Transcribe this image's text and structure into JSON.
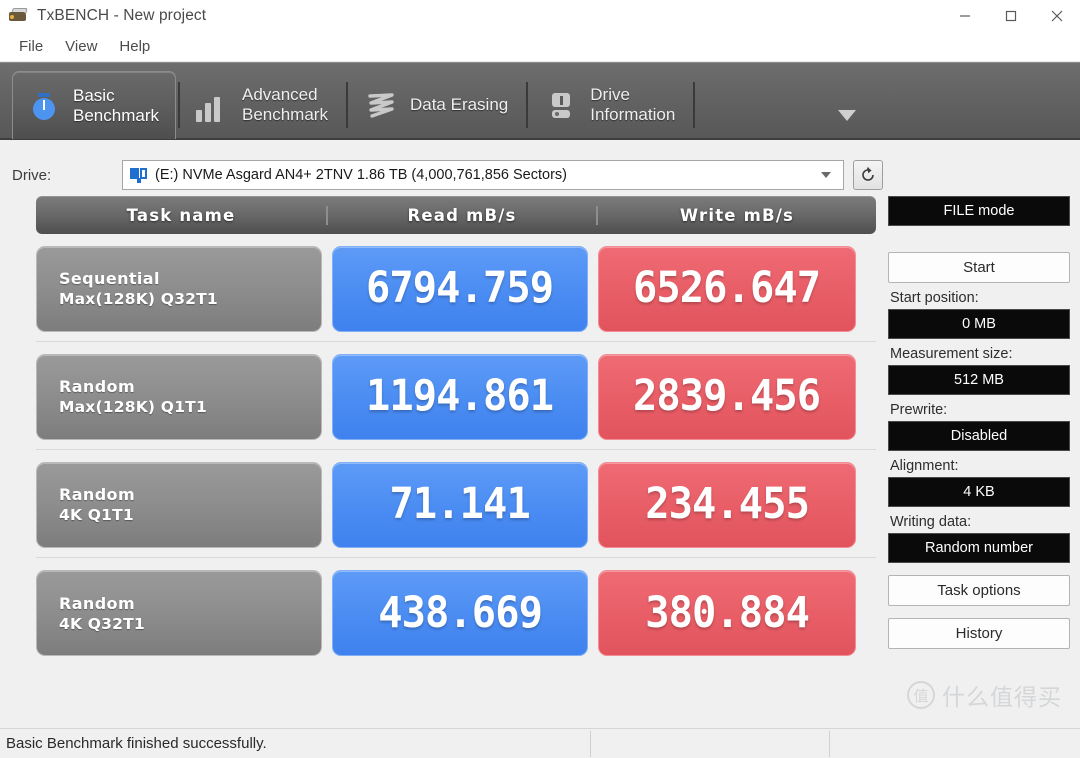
{
  "window": {
    "title": "TxBENCH - New project",
    "app_icon": "hdd-icon",
    "controls": [
      {
        "name": "minimize-button",
        "glyph": "minimize-icon"
      },
      {
        "name": "maximize-button",
        "glyph": "maximize-icon"
      },
      {
        "name": "close-button",
        "glyph": "close-icon"
      }
    ]
  },
  "menubar": {
    "items": [
      {
        "label": "File"
      },
      {
        "label": "View"
      },
      {
        "label": "Help"
      }
    ]
  },
  "tabs": {
    "overflow_icon": "chevron-down-icon",
    "items": [
      {
        "label": "Basic\nBenchmark",
        "icon": "stopwatch-icon",
        "active": true
      },
      {
        "label": "Advanced\nBenchmark",
        "icon": "bar-chart-icon",
        "active": false
      },
      {
        "label": "Data Erasing",
        "icon": "eraser-icon",
        "active": false
      },
      {
        "label": "Drive\nInformation",
        "icon": "drive-info-icon",
        "active": false
      }
    ]
  },
  "drive": {
    "label": "Drive:",
    "icon": "hdd-icon",
    "selected": "(E:) NVMe Asgard AN4+ 2TNV  1.86 TB (4,000,761,856 Sectors)",
    "dropdown_icon": "chevron-down-icon",
    "refresh_icon": "refresh-icon"
  },
  "table": {
    "headers": {
      "task": "Task name",
      "read": "Read mB/s",
      "write": "Write mB/s"
    },
    "rows": [
      {
        "task_line1": "Sequential",
        "task_line2": "Max(128K) Q32T1",
        "read": "6794.759",
        "write": "6526.647"
      },
      {
        "task_line1": "Random",
        "task_line2": "Max(128K) Q1T1",
        "read": "1194.861",
        "write": "2839.456"
      },
      {
        "task_line1": "Random",
        "task_line2": "4K Q1T1",
        "read": "71.141",
        "write": "234.455"
      },
      {
        "task_line1": "Random",
        "task_line2": "4K Q32T1",
        "read": "438.669",
        "write": "380.884"
      }
    ]
  },
  "panel": {
    "mode_button": "FILE mode",
    "start_button": "Start",
    "start_position_label": "Start position:",
    "start_position_value": "0 MB",
    "measurement_size_label": "Measurement size:",
    "measurement_size_value": "512 MB",
    "prewrite_label": "Prewrite:",
    "prewrite_value": "Disabled",
    "alignment_label": "Alignment:",
    "alignment_value": "4 KB",
    "writing_data_label": "Writing data:",
    "writing_data_value": "Random number",
    "task_options_button": "Task options",
    "history_button": "History"
  },
  "statusbar": {
    "message": "Basic Benchmark finished successfully.",
    "segment2": "",
    "segment3": ""
  },
  "watermark": {
    "badge": "值",
    "text": "什么值得买"
  },
  "colors": {
    "read_blue": "#4a8cf2",
    "write_red": "#e85d66",
    "tab_bar": "#636363",
    "task_grey": "#8d8d8d",
    "panel_black": "#0a0a0a"
  }
}
